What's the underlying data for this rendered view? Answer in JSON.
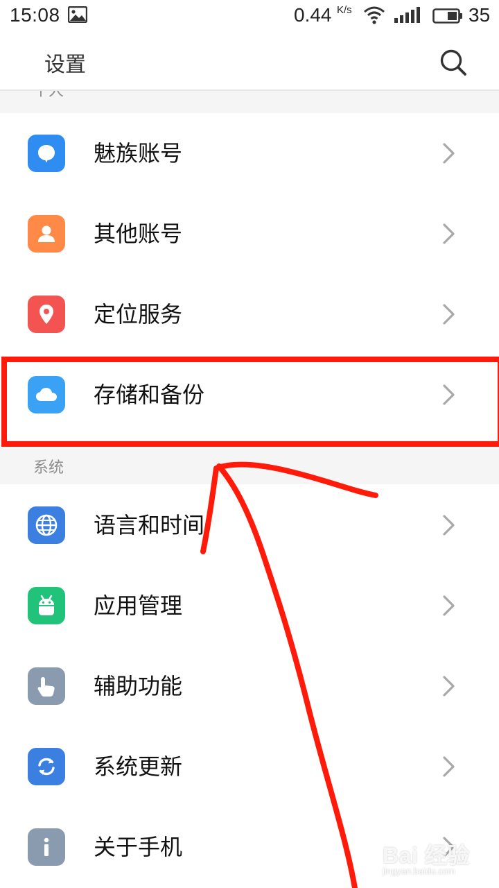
{
  "status_bar": {
    "time": "15:08",
    "net_speed": "0.44",
    "net_speed_unit": "K/s",
    "battery_level": "35"
  },
  "header": {
    "title": "设置"
  },
  "sections": {
    "personal_label": "个人",
    "system_label": "系统"
  },
  "items": [
    {
      "label": "魅族账号",
      "icon": "meizu-account-icon",
      "color": "#2f8cf0"
    },
    {
      "label": "其他账号",
      "icon": "person-icon",
      "color": "#ff8a48"
    },
    {
      "label": "定位服务",
      "icon": "location-pin-icon",
      "color": "#f35452"
    },
    {
      "label": "存储和备份",
      "icon": "cloud-icon",
      "color": "#3aa2f5"
    },
    {
      "label": "语言和时间",
      "icon": "globe-icon",
      "color": "#3b7fe0"
    },
    {
      "label": "应用管理",
      "icon": "android-icon",
      "color": "#21c27a"
    },
    {
      "label": "辅助功能",
      "icon": "hand-pointer-icon",
      "color": "#8a9bb0"
    },
    {
      "label": "系统更新",
      "icon": "sync-icon",
      "color": "#3b7fe0"
    },
    {
      "label": "关于手机",
      "icon": "info-icon",
      "color": "#8a9bb0"
    }
  ],
  "annotation": {
    "highlight_color": "#ff1a0a"
  },
  "watermark": {
    "brand": "Bai 经验",
    "sub": "jingyan.baidu.com"
  }
}
